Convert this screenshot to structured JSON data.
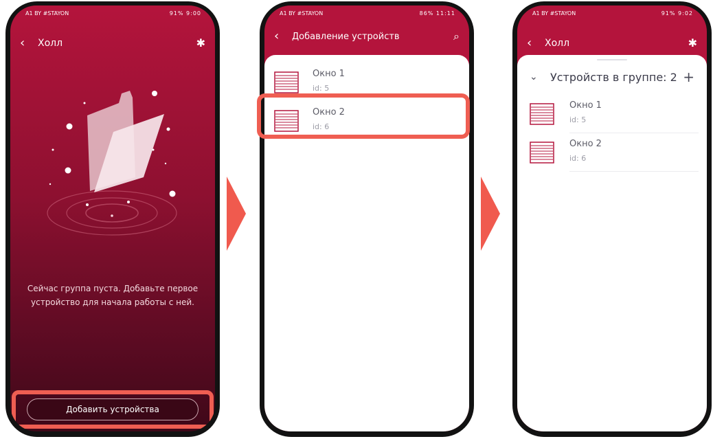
{
  "status_bars": {
    "s1": {
      "left": "A1 BY #STAYON",
      "right": "91% 9:00"
    },
    "s2": {
      "left": "A1 BY #STAYON",
      "right": "86% 11:11"
    },
    "s3": {
      "left": "A1 BY #STAYON",
      "right": "91% 9:02"
    }
  },
  "screen1": {
    "back": "‹",
    "title": "Холл",
    "gear": "✱",
    "empty_text": "Сейчас группа пуста. Добавьте первое устройство для начала работы с ней.",
    "add_button": "Добавить устройства"
  },
  "screen2": {
    "back": "‹",
    "title": "Добавление устройств",
    "search": "⌕",
    "items": [
      {
        "name": "Окно 1",
        "id": "id: 5"
      },
      {
        "name": "Окно 2",
        "id": "id: 6"
      }
    ]
  },
  "screen3": {
    "back": "‹",
    "title": "Холл",
    "gear": "✱",
    "group_chev": "⌄",
    "group_title": "Устройств в группе: 2",
    "group_plus": "+",
    "items": [
      {
        "name": "Окно 1",
        "id": "id: 5"
      },
      {
        "name": "Окно 2",
        "id": "id: 6"
      }
    ]
  },
  "colors": {
    "accent_red": "#b4143c",
    "highlight": "#ef5e52",
    "arrow": "#f05a4e"
  },
  "icons": [
    "back-chevron-icon",
    "gear-icon",
    "search-icon",
    "window-blind-icon",
    "empty-folder-illustration",
    "arrow-right-icon",
    "chevron-down-icon",
    "plus-icon"
  ]
}
